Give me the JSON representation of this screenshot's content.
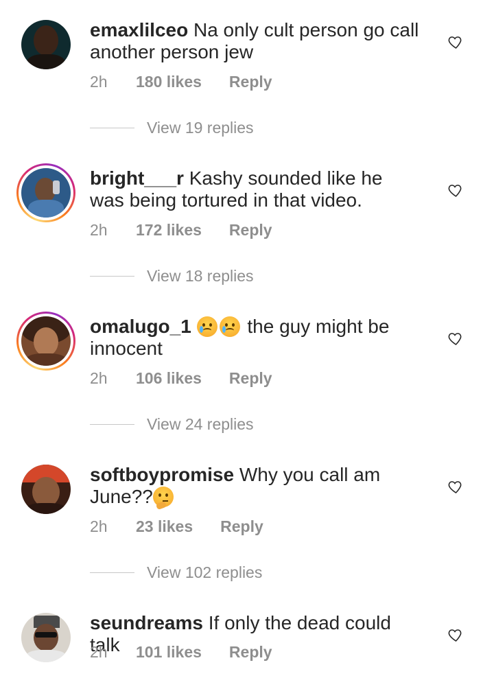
{
  "comments": [
    {
      "username": "emaxlilceo",
      "text": "Na only cult person go call another person jew",
      "time": "2h",
      "likes": "180 likes",
      "reply": "Reply",
      "view_replies": "View 19 replies",
      "avatar_ring": false
    },
    {
      "username": "bright___r",
      "text": "Kashy sounded like he was being tortured in that video.",
      "time": "2h",
      "likes": "172 likes",
      "reply": "Reply",
      "view_replies": "View 18 replies",
      "avatar_ring": true
    },
    {
      "username": "omalugo_1",
      "text_after_emoji": "the guy might be innocent",
      "emojis": [
        "crying-face-icon",
        "crying-face-icon"
      ],
      "time": "2h",
      "likes": "106 likes",
      "reply": "Reply",
      "view_replies": "View 24 replies",
      "avatar_ring": true
    },
    {
      "username": "softboypromise",
      "text": "Why you call am June??",
      "emojis": [
        "thinking-face-icon"
      ],
      "time": "2h",
      "likes": "23 likes",
      "reply": "Reply",
      "view_replies": "View 102 replies",
      "avatar_ring": false
    },
    {
      "username": "seundreams",
      "text": "If only the dead could talk",
      "time": "2h",
      "likes": "101 likes",
      "reply": "Reply",
      "avatar_ring": false
    }
  ],
  "icons": {
    "like": "heart-outline-icon"
  },
  "colors": {
    "text": "#262626",
    "secondary": "#8e8e8e",
    "story_ring": [
      "#feda75",
      "#fa7e1e",
      "#d62976",
      "#962fbf"
    ]
  }
}
